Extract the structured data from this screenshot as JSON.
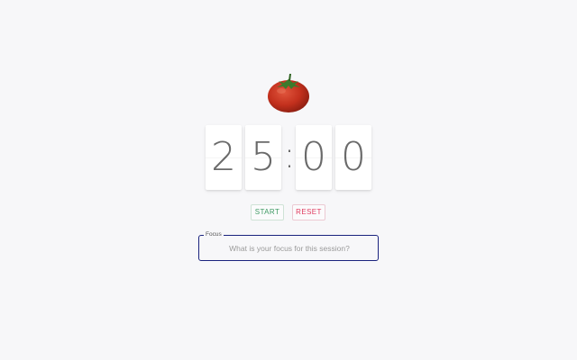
{
  "app": {
    "logo_icon": "tomato-icon"
  },
  "timer": {
    "minutes_tens": "2",
    "minutes_ones": "5",
    "separator": ":",
    "seconds_tens": "0",
    "seconds_ones": "0"
  },
  "controls": {
    "start_label": "START",
    "reset_label": "RESET"
  },
  "focus": {
    "label": "Focus",
    "placeholder": "What is your focus for this session?",
    "value": ""
  },
  "colors": {
    "background": "#f7f7f9",
    "start": "#3e9a63",
    "reset": "#e03b5f",
    "focus_border": "#1a237e",
    "tomato": "#c8321f"
  }
}
